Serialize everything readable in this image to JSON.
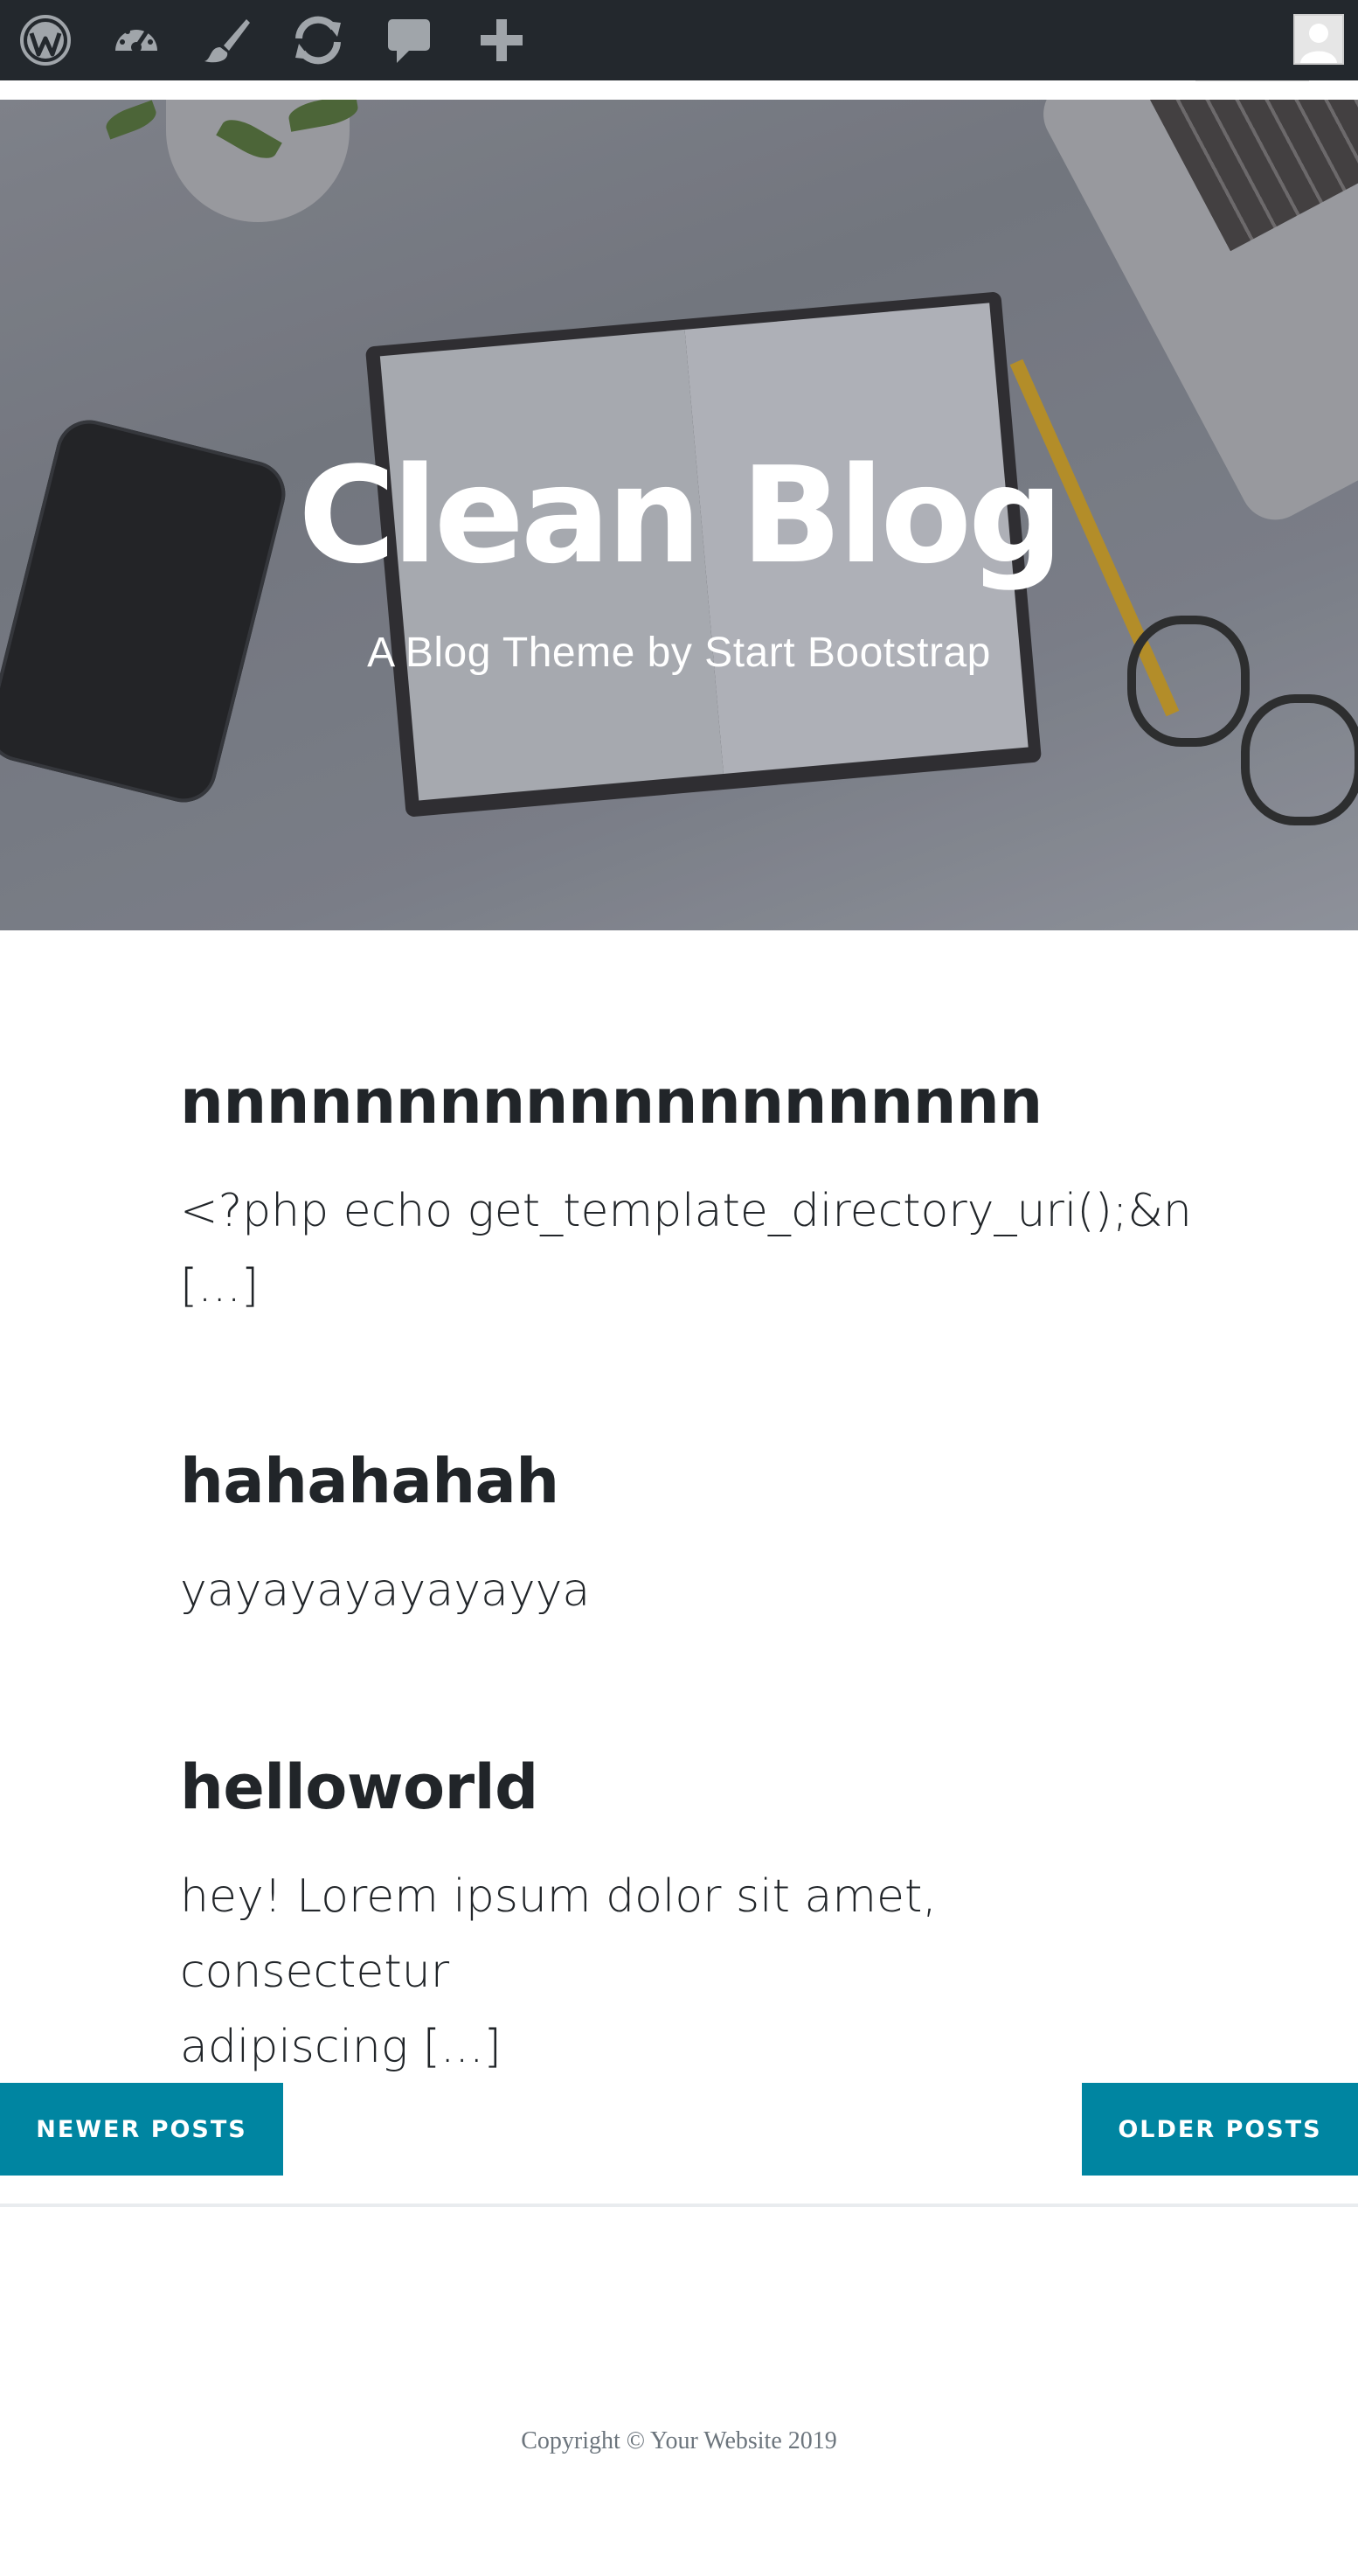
{
  "admin_bar": {
    "icons": [
      "wordpress-logo-icon",
      "dashboard-gauge-icon",
      "customize-brush-icon",
      "updates-refresh-icon",
      "comments-bubble-icon",
      "new-content-plus-icon"
    ],
    "avatar": "user-avatar-icon",
    "background_color": "#23282d",
    "icon_color": "#a0a5aa"
  },
  "hero": {
    "title": "Clean Blog",
    "subtitle": "A Blog Theme by Start Bootstrap"
  },
  "posts": [
    {
      "title": "nnnnnnnnnnnnnnnnnnnn",
      "excerpt_line1": "<?php echo get_template_directory_uri();&n",
      "excerpt_line2": "[...]"
    },
    {
      "title": "hahahahah",
      "excerpt_line1": "yayayayayayayya"
    },
    {
      "title": "helloworld",
      "excerpt_line1": "hey! Lorem ipsum dolor sit amet, consectetur",
      "excerpt_line2": "adipiscing [...]"
    }
  ],
  "pager": {
    "newer_label": "NEWER POSTS",
    "older_label": "OLDER POSTS",
    "button_color": "#0085a1"
  },
  "footer": {
    "copyright": "Copyright © Your Website 2019"
  }
}
